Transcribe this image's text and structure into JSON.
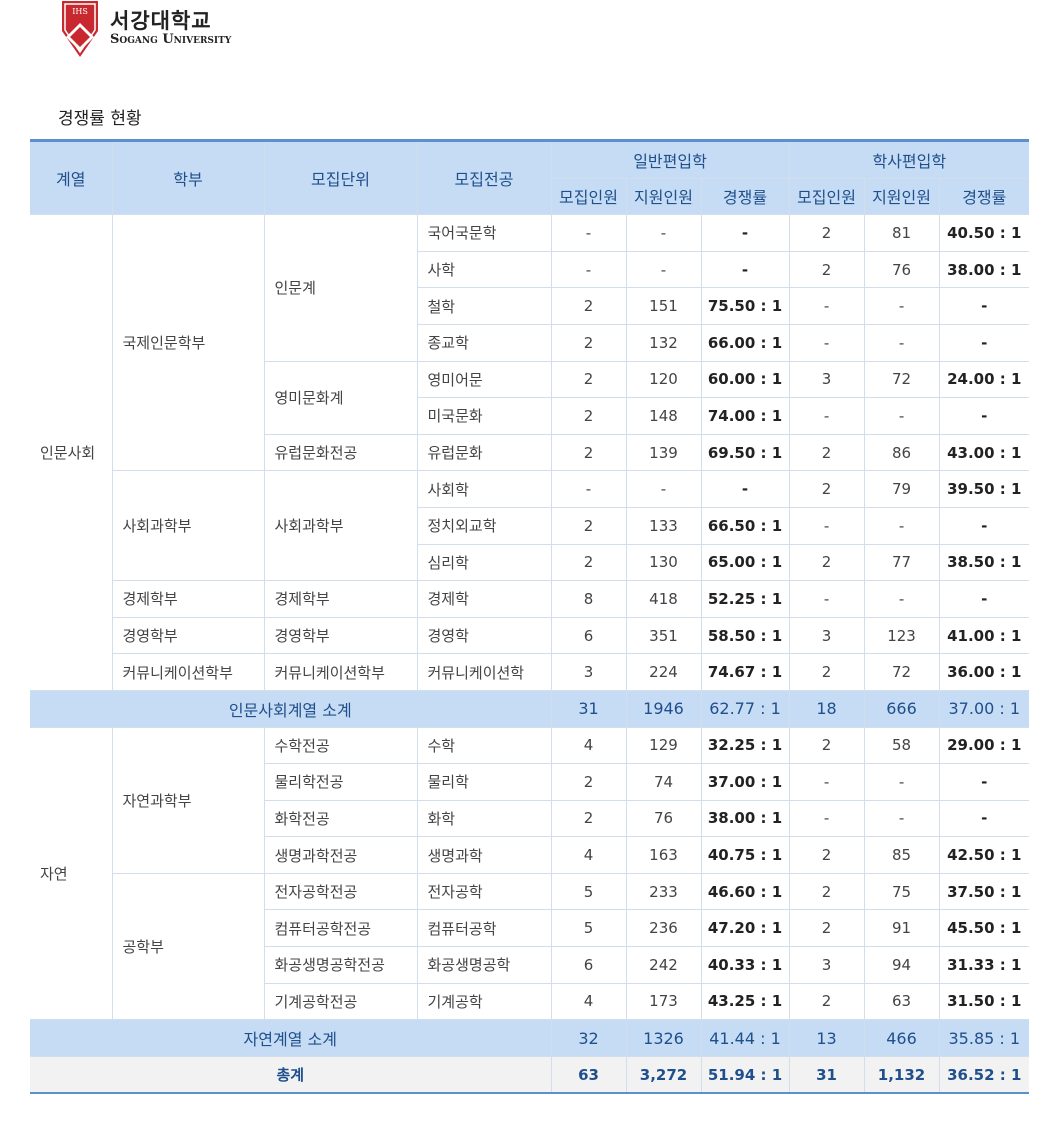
{
  "logo": {
    "name_ko": "서강대학교",
    "name_en": "Sogang University",
    "emblem_text": "IHS"
  },
  "section_title": "경쟁률 현황",
  "headers": {
    "field": "계열",
    "school": "학부",
    "unit": "모집단위",
    "major": "모집전공",
    "general": "일반편입학",
    "bachelor": "학사편입학",
    "recruit": "모집인원",
    "applicants": "지원인원",
    "ratio": "경쟁률"
  },
  "rows": {
    "r1": {
      "field": "인문사회",
      "school": "국제인문학부",
      "unit": "인문계",
      "major": "국어국문학",
      "g_recruit": "-",
      "g_apply": "-",
      "g_ratio": "-",
      "b_recruit": "2",
      "b_apply": "81",
      "b_ratio": "40.50 : 1"
    },
    "r2": {
      "major": "사학",
      "g_recruit": "-",
      "g_apply": "-",
      "g_ratio": "-",
      "b_recruit": "2",
      "b_apply": "76",
      "b_ratio": "38.00 : 1"
    },
    "r3": {
      "major": "철학",
      "g_recruit": "2",
      "g_apply": "151",
      "g_ratio": "75.50 : 1",
      "b_recruit": "-",
      "b_apply": "-",
      "b_ratio": "-"
    },
    "r4": {
      "major": "종교학",
      "g_recruit": "2",
      "g_apply": "132",
      "g_ratio": "66.00 : 1",
      "b_recruit": "-",
      "b_apply": "-",
      "b_ratio": "-"
    },
    "r5": {
      "unit": "영미문화계",
      "major": "영미어문",
      "g_recruit": "2",
      "g_apply": "120",
      "g_ratio": "60.00 : 1",
      "b_recruit": "3",
      "b_apply": "72",
      "b_ratio": "24.00 : 1"
    },
    "r6": {
      "major": "미국문화",
      "g_recruit": "2",
      "g_apply": "148",
      "g_ratio": "74.00 : 1",
      "b_recruit": "-",
      "b_apply": "-",
      "b_ratio": "-"
    },
    "r7": {
      "unit": "유럽문화전공",
      "major": "유럽문화",
      "g_recruit": "2",
      "g_apply": "139",
      "g_ratio": "69.50 : 1",
      "b_recruit": "2",
      "b_apply": "86",
      "b_ratio": "43.00 : 1"
    },
    "r8": {
      "school": "사회과학부",
      "unit": "사회과학부",
      "major": "사회학",
      "g_recruit": "-",
      "g_apply": "-",
      "g_ratio": "-",
      "b_recruit": "2",
      "b_apply": "79",
      "b_ratio": "39.50 : 1"
    },
    "r9": {
      "major": "정치외교학",
      "g_recruit": "2",
      "g_apply": "133",
      "g_ratio": "66.50 : 1",
      "b_recruit": "-",
      "b_apply": "-",
      "b_ratio": "-"
    },
    "r10": {
      "major": "심리학",
      "g_recruit": "2",
      "g_apply": "130",
      "g_ratio": "65.00 : 1",
      "b_recruit": "2",
      "b_apply": "77",
      "b_ratio": "38.50 : 1"
    },
    "r11": {
      "school": "경제학부",
      "unit": "경제학부",
      "major": "경제학",
      "g_recruit": "8",
      "g_apply": "418",
      "g_ratio": "52.25 : 1",
      "b_recruit": "-",
      "b_apply": "-",
      "b_ratio": "-"
    },
    "r12": {
      "school": "경영학부",
      "unit": "경영학부",
      "major": "경영학",
      "g_recruit": "6",
      "g_apply": "351",
      "g_ratio": "58.50 : 1",
      "b_recruit": "3",
      "b_apply": "123",
      "b_ratio": "41.00 : 1"
    },
    "r13": {
      "school": "커뮤니케이션학부",
      "unit": "커뮤니케이션학부",
      "major": "커뮤니케이션학",
      "g_recruit": "3",
      "g_apply": "224",
      "g_ratio": "74.67 : 1",
      "b_recruit": "2",
      "b_apply": "72",
      "b_ratio": "36.00 : 1"
    },
    "r14": {
      "field": "자연",
      "school": "자연과학부",
      "unit": "수학전공",
      "major": "수학",
      "g_recruit": "4",
      "g_apply": "129",
      "g_ratio": "32.25 : 1",
      "b_recruit": "2",
      "b_apply": "58",
      "b_ratio": "29.00 : 1"
    },
    "r15": {
      "unit": "물리학전공",
      "major": "물리학",
      "g_recruit": "2",
      "g_apply": "74",
      "g_ratio": "37.00 : 1",
      "b_recruit": "-",
      "b_apply": "-",
      "b_ratio": "-"
    },
    "r16": {
      "unit": "화학전공",
      "major": "화학",
      "g_recruit": "2",
      "g_apply": "76",
      "g_ratio": "38.00 : 1",
      "b_recruit": "-",
      "b_apply": "-",
      "b_ratio": "-"
    },
    "r17": {
      "unit": "생명과학전공",
      "major": "생명과학",
      "g_recruit": "4",
      "g_apply": "163",
      "g_ratio": "40.75 : 1",
      "b_recruit": "2",
      "b_apply": "85",
      "b_ratio": "42.50 : 1"
    },
    "r18": {
      "school": "공학부",
      "unit": "전자공학전공",
      "major": "전자공학",
      "g_recruit": "5",
      "g_apply": "233",
      "g_ratio": "46.60 : 1",
      "b_recruit": "2",
      "b_apply": "75",
      "b_ratio": "37.50 : 1"
    },
    "r19": {
      "unit": "컴퓨터공학전공",
      "major": "컴퓨터공학",
      "g_recruit": "5",
      "g_apply": "236",
      "g_ratio": "47.20 : 1",
      "b_recruit": "2",
      "b_apply": "91",
      "b_ratio": "45.50 : 1"
    },
    "r20": {
      "unit": "화공생명공학전공",
      "major": "화공생명공학",
      "g_recruit": "6",
      "g_apply": "242",
      "g_ratio": "40.33 : 1",
      "b_recruit": "3",
      "b_apply": "94",
      "b_ratio": "31.33 : 1"
    },
    "r21": {
      "unit": "기계공학전공",
      "major": "기계공학",
      "g_recruit": "4",
      "g_apply": "173",
      "g_ratio": "43.25 : 1",
      "b_recruit": "2",
      "b_apply": "63",
      "b_ratio": "31.50 : 1"
    }
  },
  "subtotals": {
    "humanities": {
      "label": "인문사회계열 소계",
      "g_recruit": "31",
      "g_apply": "1946",
      "g_ratio": "62.77 : 1",
      "b_recruit": "18",
      "b_apply": "666",
      "b_ratio": "37.00 : 1"
    },
    "science": {
      "label": "자연계열 소계",
      "g_recruit": "32",
      "g_apply": "1326",
      "g_ratio": "41.44 : 1",
      "b_recruit": "13",
      "b_apply": "466",
      "b_ratio": "35.85 : 1"
    }
  },
  "total": {
    "label": "총계",
    "g_recruit": "63",
    "g_apply": "3,272",
    "g_ratio": "51.94 : 1",
    "b_recruit": "31",
    "b_apply": "1,132",
    "b_ratio": "36.52 : 1"
  },
  "colors": {
    "header_bg": "#c6dcf5",
    "header_text": "#1f4f8c",
    "border_accent": "#5a8fd0",
    "logo_red": "#c8292f"
  }
}
